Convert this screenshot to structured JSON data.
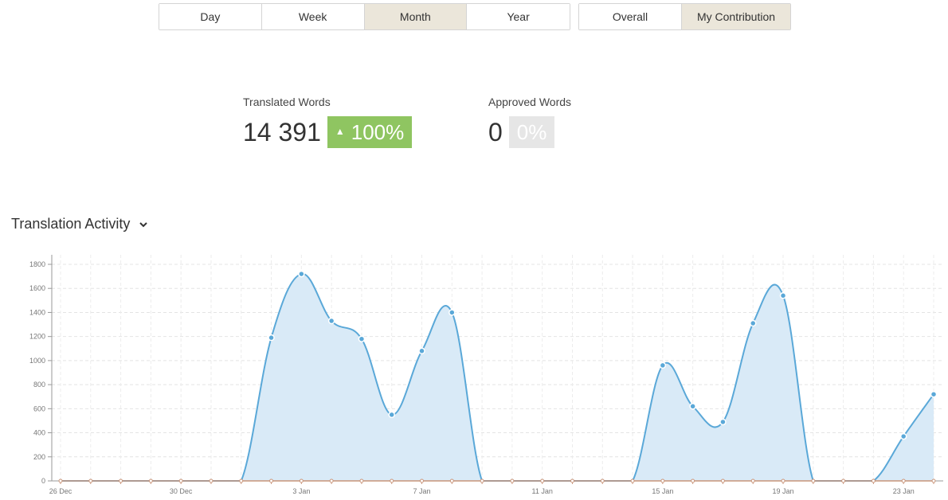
{
  "period_tabs": [
    {
      "label": "Day",
      "active": false
    },
    {
      "label": "Week",
      "active": false
    },
    {
      "label": "Month",
      "active": true
    },
    {
      "label": "Year",
      "active": false
    }
  ],
  "scope_tabs": [
    {
      "label": "Overall",
      "active": false
    },
    {
      "label": "My Contribution",
      "active": true
    }
  ],
  "stats": {
    "translated": {
      "label": "Translated Words",
      "value": "14 391",
      "change": "100%",
      "up_icon": "triangle-up-icon",
      "color": "#8fc561"
    },
    "approved": {
      "label": "Approved Words",
      "value": "0",
      "change": "0%",
      "color": "#e6e6e6"
    }
  },
  "section": {
    "title": "Translation Activity",
    "toggle_icon": "chevron-down-icon"
  },
  "chart_data": {
    "type": "area",
    "title": "",
    "xlabel": "",
    "ylabel": "",
    "ylim": [
      0,
      1800
    ],
    "yticks": [
      0,
      200,
      400,
      600,
      800,
      1000,
      1200,
      1400,
      1600,
      1800
    ],
    "grid": true,
    "line_color": "#5aa8d8",
    "fill_color": "#d9eaf7",
    "x_tick_labels": [
      "26 Dec",
      "30 Dec",
      "3 Jan",
      "7 Jan",
      "11 Jan",
      "15 Jan",
      "19 Jan",
      "23 Jan"
    ],
    "x_tick_indices": [
      0,
      4,
      8,
      12,
      16,
      20,
      24,
      28
    ],
    "x": [
      "26 Dec",
      "27 Dec",
      "28 Dec",
      "29 Dec",
      "30 Dec",
      "31 Dec",
      "1 Jan",
      "2 Jan",
      "3 Jan",
      "4 Jan",
      "5 Jan",
      "6 Jan",
      "7 Jan",
      "8 Jan",
      "9 Jan",
      "10 Jan",
      "11 Jan",
      "12 Jan",
      "13 Jan",
      "14 Jan",
      "15 Jan",
      "16 Jan",
      "17 Jan",
      "18 Jan",
      "19 Jan",
      "20 Jan",
      "21 Jan",
      "22 Jan",
      "23 Jan",
      "24 Jan"
    ],
    "values": [
      0,
      0,
      0,
      0,
      0,
      0,
      0,
      1190,
      1720,
      1330,
      1180,
      550,
      1080,
      1400,
      0,
      0,
      0,
      0,
      0,
      0,
      960,
      620,
      490,
      1310,
      1540,
      0,
      0,
      0,
      370,
      720
    ]
  }
}
